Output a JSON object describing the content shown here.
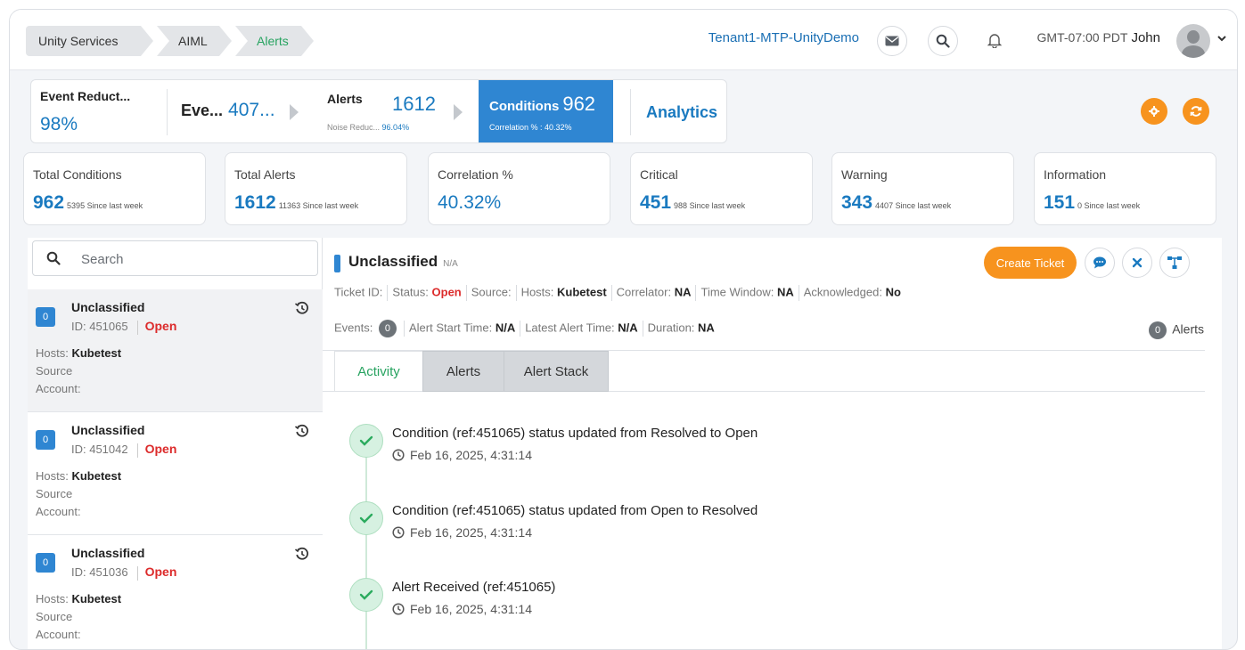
{
  "breadcrumbs": [
    "Unity Services",
    "AIML",
    "Alerts"
  ],
  "header": {
    "tenant": "Tenant1-MTP-UnityDemo",
    "timezone": "GMT-07:00 PDT",
    "user": "John"
  },
  "funnel": {
    "event_reduction": {
      "label": "Event Reduct...",
      "value": "98%"
    },
    "events": {
      "label": "Eve...",
      "value": "407..."
    },
    "alerts": {
      "label": "Alerts",
      "value": "1612",
      "sub_label": "Noise Reduc...",
      "sub_value": "96.04%"
    },
    "conditions": {
      "label": "Conditions",
      "value": "962",
      "sub": "Correlation % : 40.32%"
    },
    "analytics": "Analytics"
  },
  "stats": [
    {
      "label": "Total Conditions",
      "value": "962",
      "sub": "5395 Since last week"
    },
    {
      "label": "Total Alerts",
      "value": "1612",
      "sub": "11363 Since last week"
    },
    {
      "label": "Correlation %",
      "value": "40.32%",
      "sub": ""
    },
    {
      "label": "Critical",
      "value": "451",
      "sub": "988 Since last week"
    },
    {
      "label": "Warning",
      "value": "343",
      "sub": "4407 Since last week"
    },
    {
      "label": "Information",
      "value": "151",
      "sub": "0 Since last week"
    }
  ],
  "search": {
    "placeholder": "Search"
  },
  "conditions": [
    {
      "count": "0",
      "name": "Unclassified",
      "id": "ID: 451065",
      "status": "Open",
      "hosts_label": "Hosts:",
      "hosts": "Kubetest",
      "source": "Source",
      "account": "Account:"
    },
    {
      "count": "0",
      "name": "Unclassified",
      "id": "ID: 451042",
      "status": "Open",
      "hosts_label": "Hosts:",
      "hosts": "Kubetest",
      "source": "Source",
      "account": "Account:"
    },
    {
      "count": "0",
      "name": "Unclassified",
      "id": "ID: 451036",
      "status": "Open",
      "hosts_label": "Hosts:",
      "hosts": "Kubetest",
      "source": "Source",
      "account": "Account:"
    }
  ],
  "detail": {
    "title": "Unclassified",
    "title_sub": "N/A",
    "create_ticket": "Create Ticket",
    "meta1": {
      "ticket_id": "Ticket ID:",
      "status_label": "Status:",
      "status": "Open",
      "source_label": "Source:",
      "hosts_label": "Hosts:",
      "hosts": "Kubetest",
      "correlator_label": "Correlator:",
      "correlator": "NA",
      "time_window_label": "Time Window:",
      "time_window": "NA",
      "ack_label": "Acknowledged:",
      "ack": "No"
    },
    "meta2": {
      "events_label": "Events:",
      "events": "0",
      "start_label": "Alert Start Time:",
      "start": "N/A",
      "latest_label": "Latest Alert Time:",
      "latest": "N/A",
      "duration_label": "Duration:",
      "duration": "NA"
    },
    "alerts_count": "0",
    "alerts_count_label": "Alerts",
    "tabs": [
      "Activity",
      "Alerts",
      "Alert Stack"
    ],
    "activity": [
      {
        "text": "Condition (ref:451065) status updated from Resolved to Open",
        "time": "Feb 16, 2025, 4:31:14"
      },
      {
        "text": "Condition (ref:451065) status updated from Open to Resolved",
        "time": "Feb 16, 2025, 4:31:14"
      },
      {
        "text": "Alert Received (ref:451065)",
        "time": "Feb 16, 2025, 4:31:14"
      }
    ]
  },
  "colors": {
    "accent": "#2f86d2",
    "link": "#1a7ac0",
    "orange": "#f7931e",
    "green": "#27a360",
    "red": "#dc2b2b"
  },
  "icons": [
    "envelope-icon",
    "search-icon",
    "bell-icon",
    "user-avatar-icon",
    "chevron-down-icon",
    "gear-icon",
    "refresh-icon",
    "history-icon",
    "chat-icon",
    "close-icon",
    "topology-icon",
    "check-icon",
    "clock-icon"
  ]
}
